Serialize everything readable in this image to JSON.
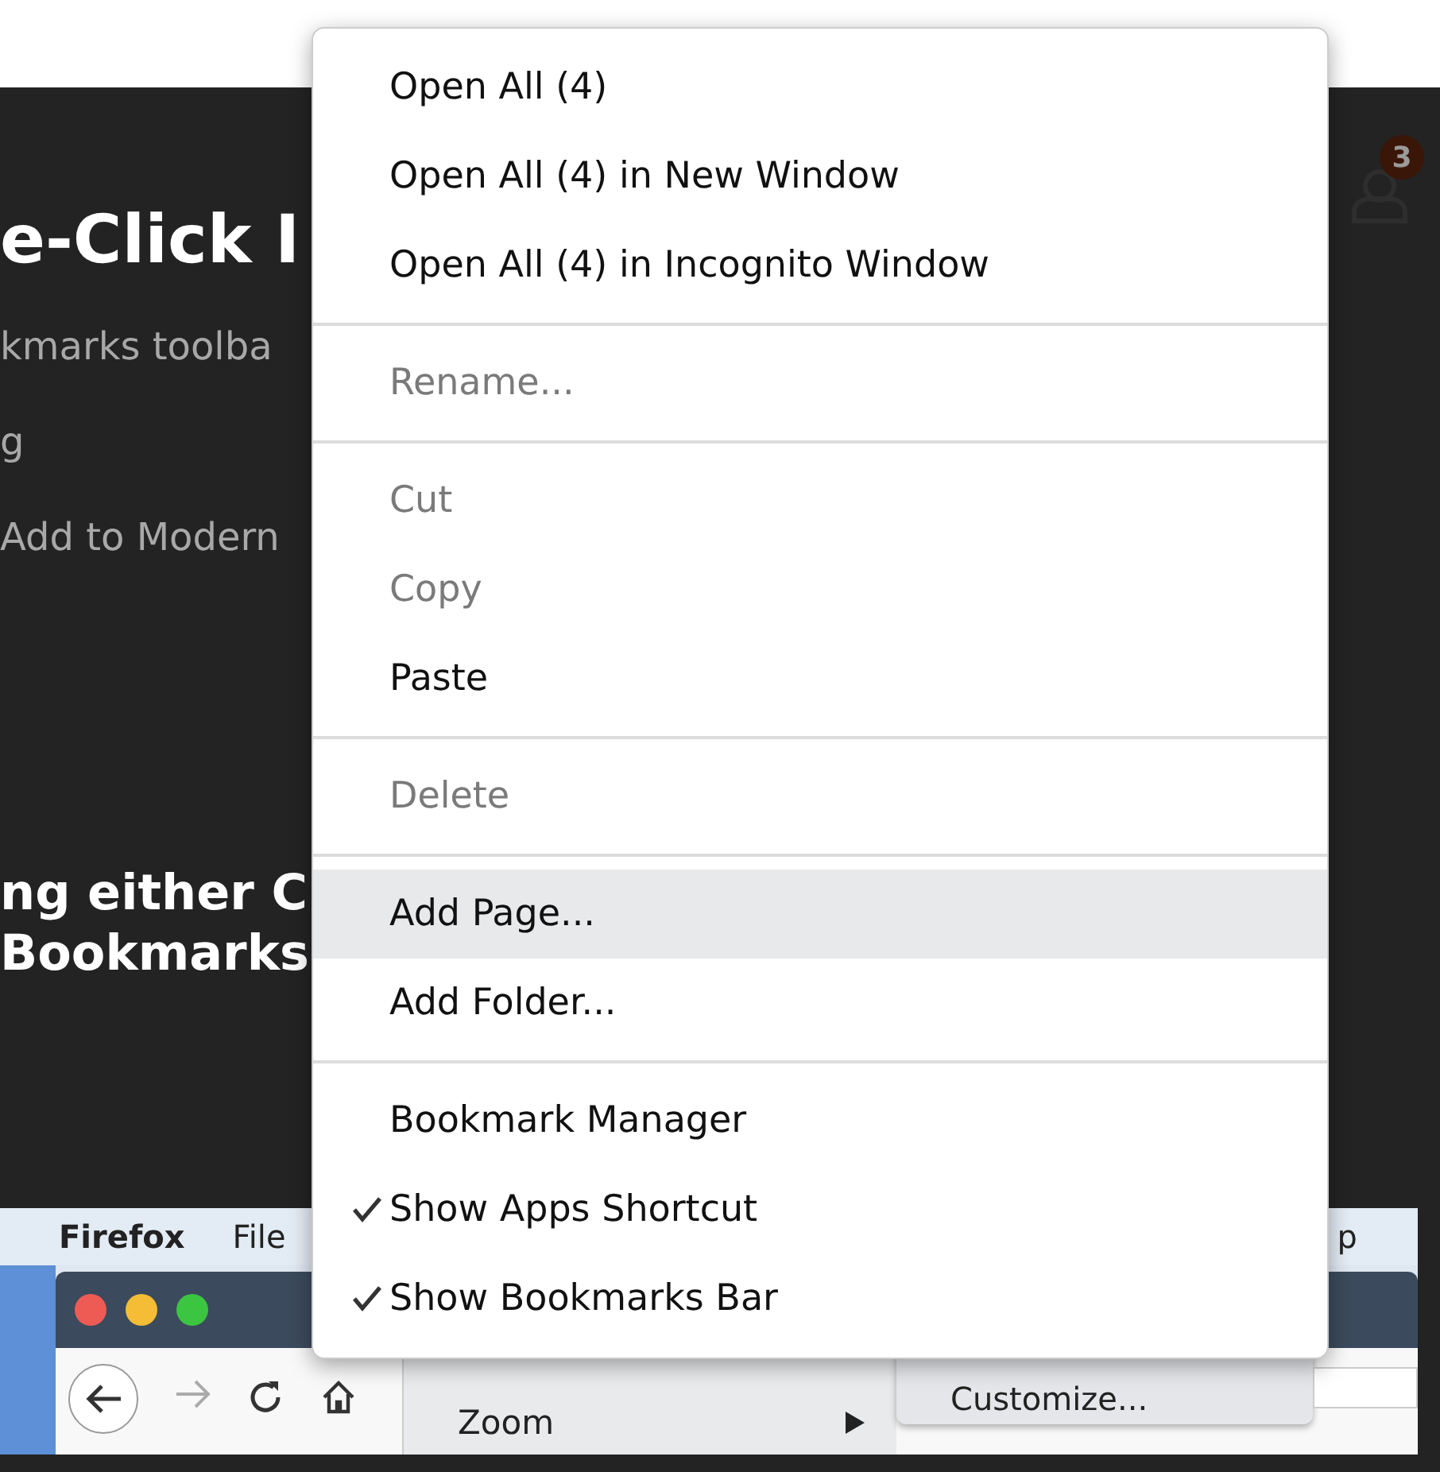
{
  "page": {
    "heading": "e-Click I",
    "lines": [
      "kmarks toolba",
      "g",
      "Add to Modern"
    ],
    "subheading": [
      "ng either C",
      "Bookmarks"
    ],
    "notifications": {
      "badge": "3"
    }
  },
  "screenshot": {
    "menubar": [
      "Firefox",
      "File",
      "p"
    ],
    "view_menu": {
      "items": [
        {
          "label": "Zoom",
          "submenu": true
        }
      ]
    },
    "submenu": {
      "items": [
        "Customize..."
      ]
    }
  },
  "context_menu": {
    "sections": [
      {
        "items": [
          {
            "label": "Open All (4)",
            "disabled": false,
            "selected": false,
            "checked": false
          },
          {
            "label": "Open All (4) in New Window",
            "disabled": false,
            "selected": false,
            "checked": false
          },
          {
            "label": "Open All (4) in Incognito Window",
            "disabled": false,
            "selected": false,
            "checked": false
          }
        ]
      },
      {
        "items": [
          {
            "label": "Rename...",
            "disabled": true,
            "selected": false,
            "checked": false
          }
        ]
      },
      {
        "items": [
          {
            "label": "Cut",
            "disabled": true,
            "selected": false,
            "checked": false
          },
          {
            "label": "Copy",
            "disabled": true,
            "selected": false,
            "checked": false
          },
          {
            "label": "Paste",
            "disabled": false,
            "selected": false,
            "checked": false
          }
        ]
      },
      {
        "items": [
          {
            "label": "Delete",
            "disabled": true,
            "selected": false,
            "checked": false
          }
        ]
      },
      {
        "items": [
          {
            "label": "Add Page...",
            "disabled": false,
            "selected": true,
            "checked": false
          },
          {
            "label": "Add Folder...",
            "disabled": false,
            "selected": false,
            "checked": false
          }
        ]
      },
      {
        "items": [
          {
            "label": "Bookmark Manager",
            "disabled": false,
            "selected": false,
            "checked": false
          },
          {
            "label": "Show Apps Shortcut",
            "disabled": false,
            "selected": false,
            "checked": true
          },
          {
            "label": "Show Bookmarks Bar",
            "disabled": false,
            "selected": false,
            "checked": true
          }
        ]
      }
    ]
  }
}
